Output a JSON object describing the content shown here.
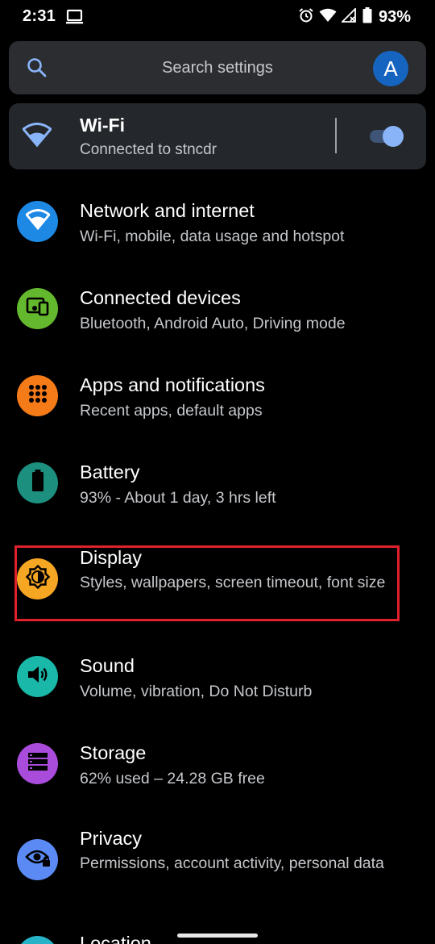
{
  "status_bar": {
    "time": "2:31",
    "battery_percent": "93%"
  },
  "search": {
    "placeholder": "Search settings",
    "avatar_letter": "A"
  },
  "wifi_card": {
    "title": "Wi-Fi",
    "subtitle": "Connected to stncdr",
    "toggle_on": true
  },
  "items": [
    {
      "title": "Network and internet",
      "subtitle": "Wi-Fi, mobile, data usage and hotspot",
      "icon": "wifi-icon",
      "color": "#1e88e5"
    },
    {
      "title": "Connected devices",
      "subtitle": "Bluetooth, Android Auto, Driving mode",
      "icon": "devices-icon",
      "color": "#64b82d"
    },
    {
      "title": "Apps and notifications",
      "subtitle": "Recent apps, default apps",
      "icon": "apps-icon",
      "color": "#f57a18"
    },
    {
      "title": "Battery",
      "subtitle": "93% - About 1 day, 3 hrs left",
      "icon": "battery-icon",
      "color": "#1c8f7e"
    },
    {
      "title": "Display",
      "subtitle": "Styles, wallpapers, screen timeout, font size",
      "icon": "brightness-icon",
      "color": "#f5a623"
    },
    {
      "title": "Sound",
      "subtitle": "Volume, vibration, Do Not Disturb",
      "icon": "volume-icon",
      "color": "#19b8a8"
    },
    {
      "title": "Storage",
      "subtitle": "62% used – 24.28 GB free",
      "icon": "storage-icon",
      "color": "#a94cdc"
    },
    {
      "title": "Privacy",
      "subtitle": "Permissions, account activity, personal data",
      "icon": "privacy-eye-icon",
      "color": "#5c8af5"
    },
    {
      "title": "Location",
      "subtitle": "",
      "icon": "location-icon",
      "color": "#26b3c7"
    }
  ],
  "colors": {
    "background": "#000000",
    "card": "#24272b",
    "highlight": "#e0202a",
    "toggle_thumb": "#8ab4f8"
  }
}
